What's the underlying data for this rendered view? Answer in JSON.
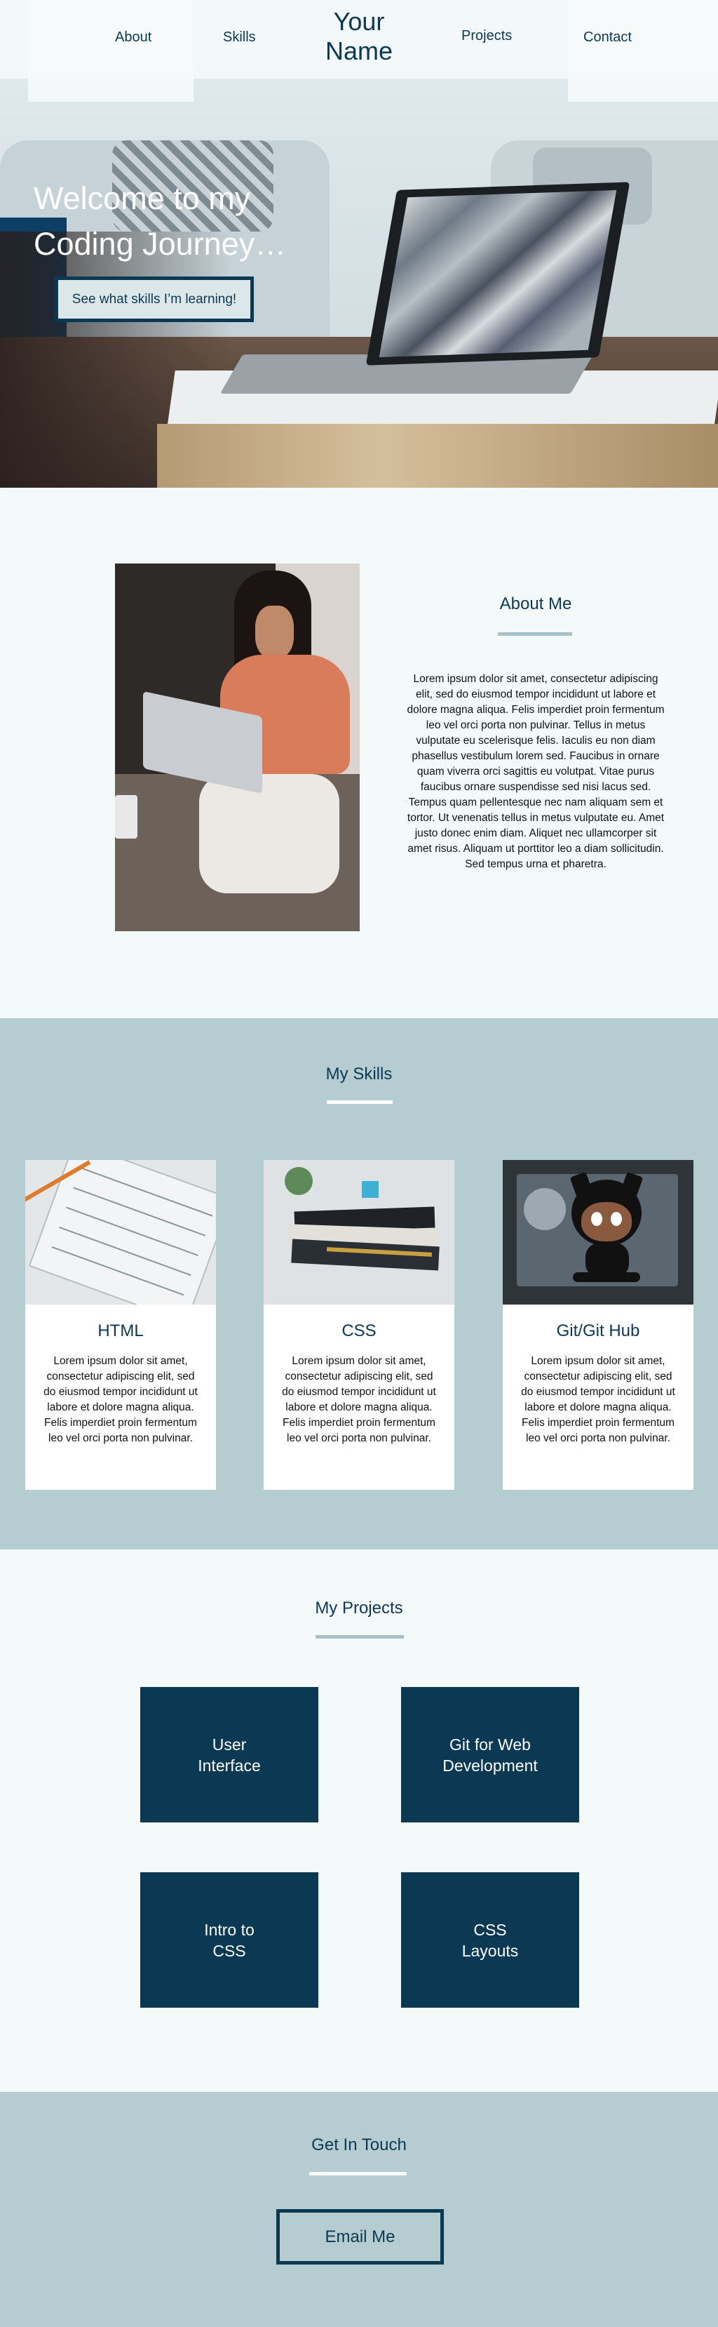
{
  "nav": {
    "about": "About",
    "skills": "Skills",
    "brand": "Your Name",
    "projects": "Projects",
    "contact": "Contact"
  },
  "hero": {
    "title": "Welcome to my Coding Journey…",
    "cta_label": "See what skills I’m learning!"
  },
  "about": {
    "heading": "About Me",
    "body": "Lorem ipsum dolor sit amet, consectetur adipiscing elit, sed do eiusmod tempor incididunt ut labore et dolore magna aliqua. Felis imperdiet proin fermentum leo vel orci porta non pulvinar. Tellus in metus vulputate eu scelerisque felis. Iaculis eu non diam phasellus vestibulum lorem sed. Faucibus in ornare quam viverra orci sagittis eu volutpat. Vitae purus faucibus ornare suspendisse sed nisi lacus sed. Tempus quam pellentesque nec nam aliquam sem et tortor. Ut venenatis tellus in metus vulputate eu. Amet justo donec enim diam. Aliquet nec ullamcorper sit amet risus. Aliquam ut porttitor leo a diam sollicitudin. Sed tempus urna et pharetra."
  },
  "skills": {
    "heading": "My Skills",
    "cards": [
      {
        "title": "HTML",
        "body": "Lorem ipsum dolor sit amet, consectetur adipiscing elit, sed do eiusmod tempor incididunt ut labore et dolore magna aliqua. Felis imperdiet proin fermentum leo vel orci porta non pulvinar."
      },
      {
        "title": "CSS",
        "body": "Lorem ipsum dolor sit amet, consectetur adipiscing elit, sed do eiusmod tempor incididunt ut labore et dolore magna aliqua. Felis imperdiet proin fermentum leo vel orci porta non pulvinar."
      },
      {
        "title": "Git/Git Hub",
        "body": "Lorem ipsum dolor sit amet, consectetur adipiscing elit, sed do eiusmod tempor incididunt ut labore et dolore magna aliqua. Felis imperdiet proin fermentum leo vel orci porta non pulvinar."
      }
    ]
  },
  "projects": {
    "heading": "My Projects",
    "tiles": [
      {
        "line1": "User",
        "line2": "Interface"
      },
      {
        "line1": "Git for Web",
        "line2": "Development"
      },
      {
        "line1": "Intro to",
        "line2": "CSS"
      },
      {
        "line1": "CSS",
        "line2": "Layouts"
      }
    ]
  },
  "contact": {
    "heading": "Get In Touch",
    "email_label": "Email Me"
  },
  "colors": {
    "primary": "#0b3954",
    "section_teal": "#b5cdd0",
    "page_bg": "#f4f9fa",
    "rule_light": "#a6c2c6"
  }
}
